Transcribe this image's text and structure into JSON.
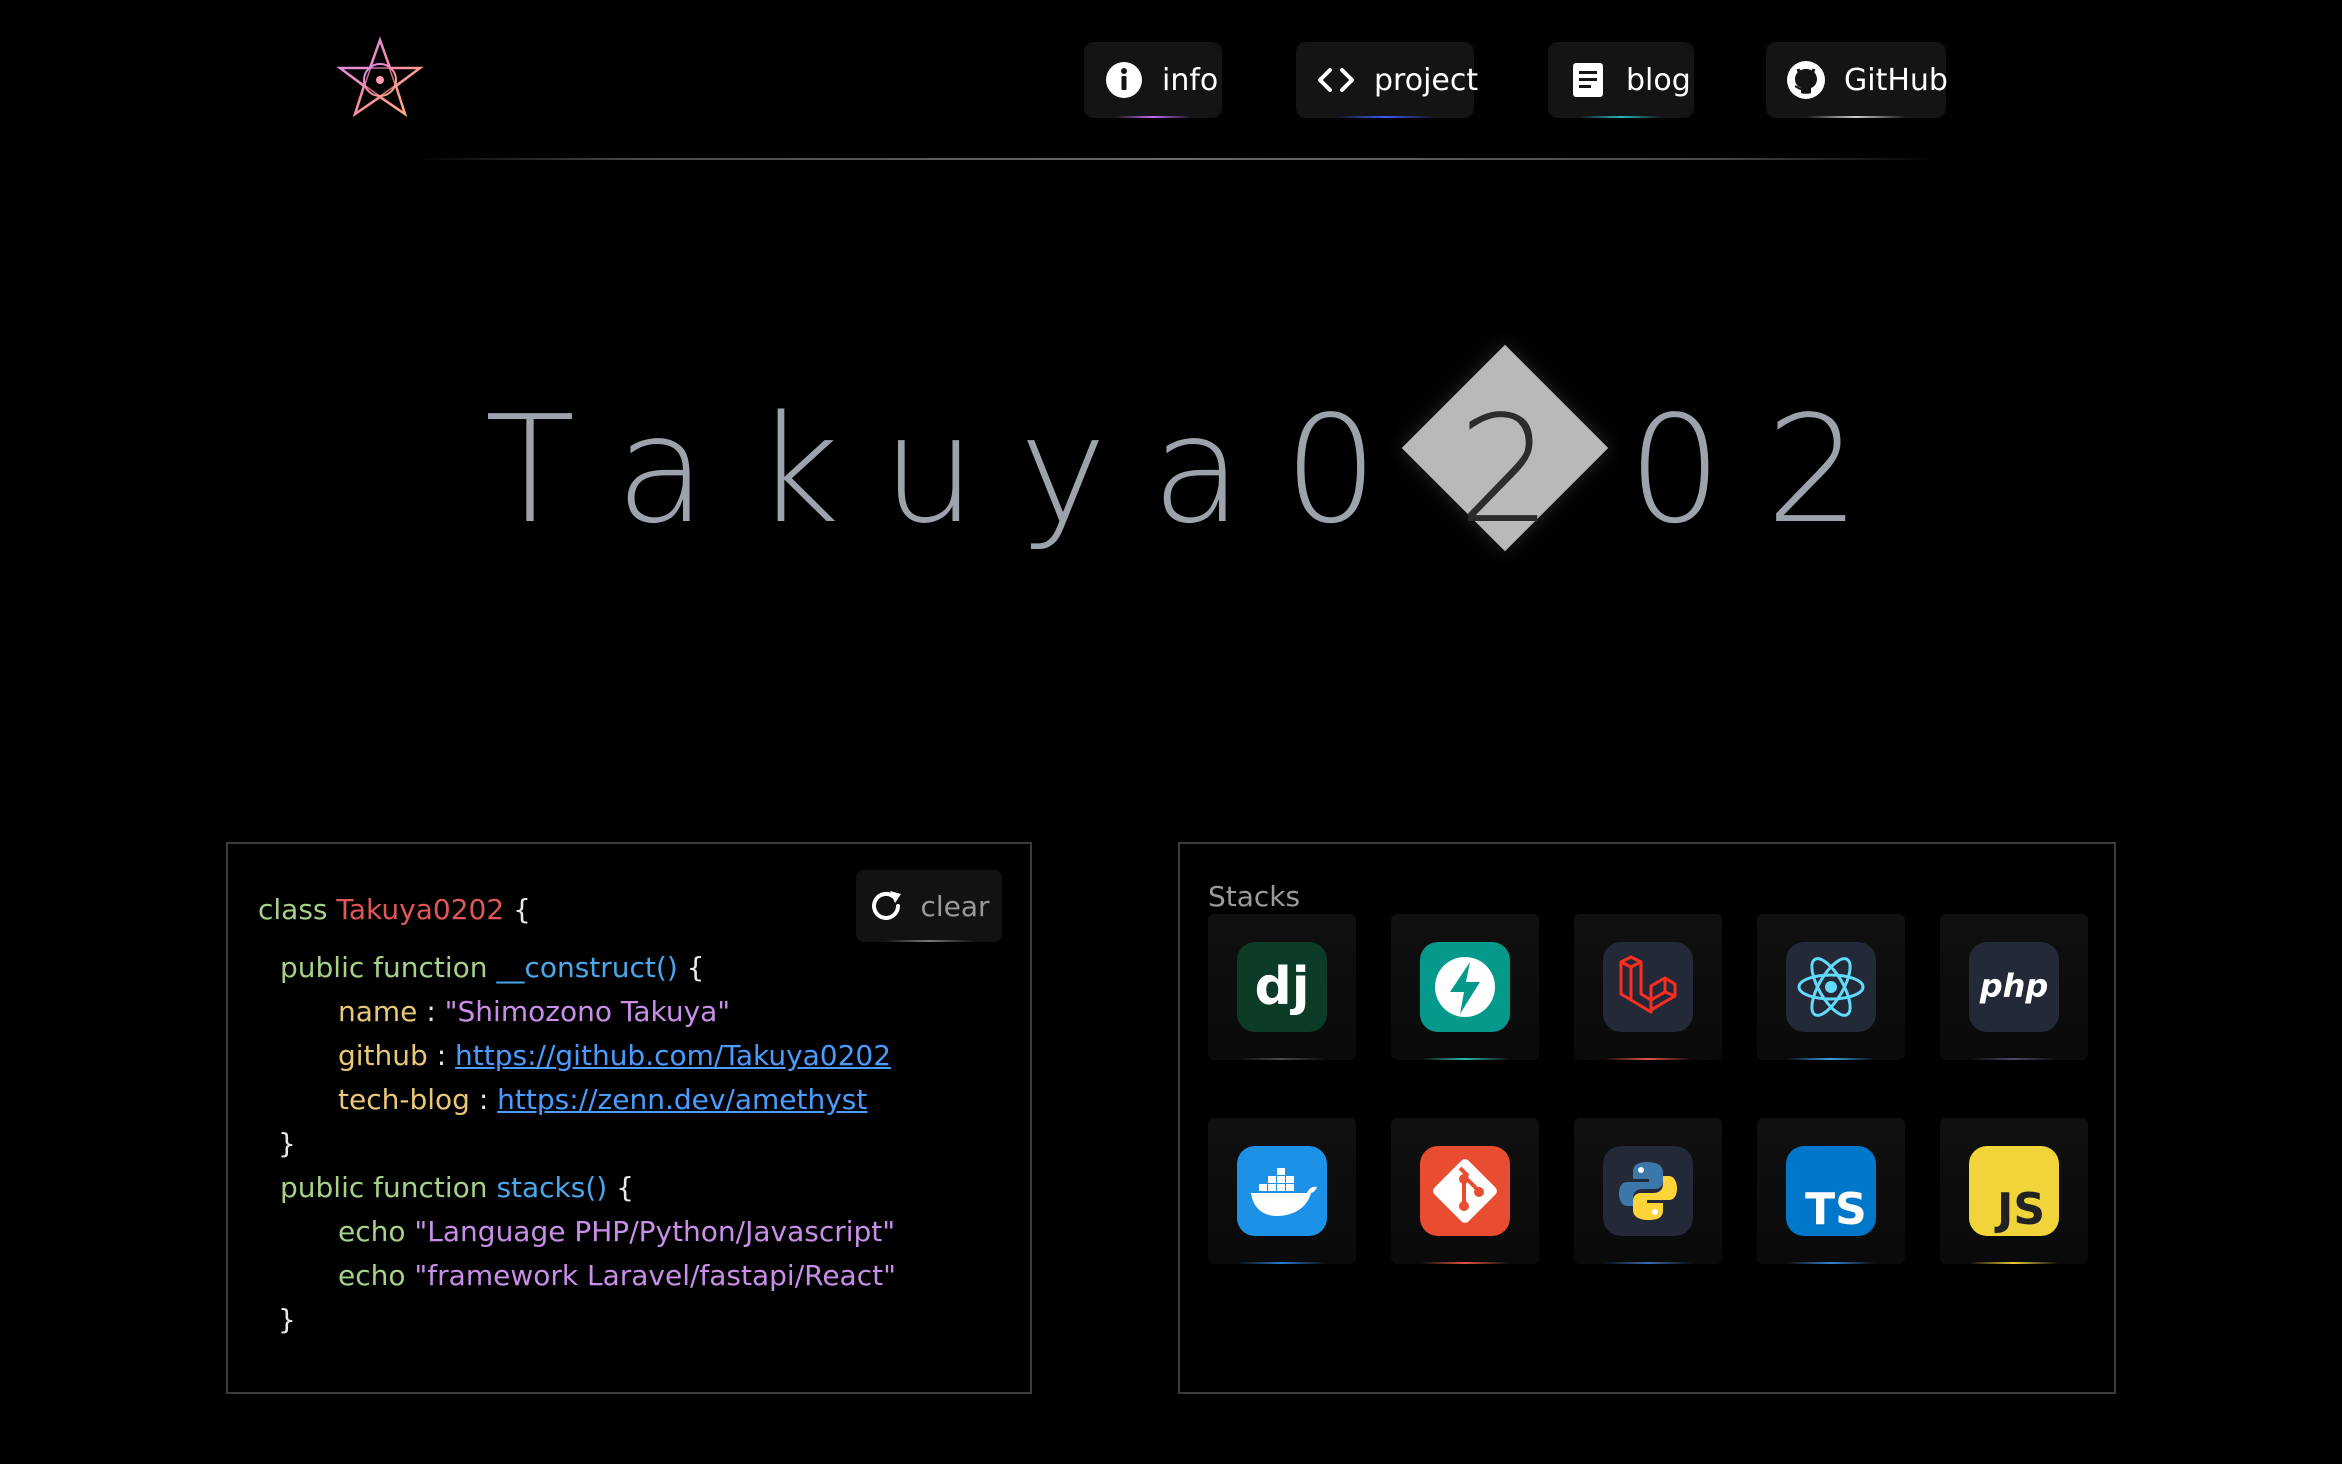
{
  "header": {
    "nav": [
      {
        "label": "info",
        "icon": "info-icon"
      },
      {
        "label": "project",
        "icon": "code-icon"
      },
      {
        "label": "blog",
        "icon": "document-icon"
      },
      {
        "label": "GitHub",
        "icon": "github-icon"
      }
    ]
  },
  "hero": {
    "title": [
      "T",
      "a",
      "k",
      "u",
      "y",
      "a",
      "0",
      "2",
      "0",
      "2"
    ],
    "highlighted_index": 7
  },
  "code": {
    "class_kw": "class",
    "class_name": "Takuya0202",
    "open_brace": "{",
    "construct_kw": "public function",
    "construct_fn": "__construct()",
    "construct_brace": "{",
    "name_key": "name",
    "name_value": "\"Shimozono Takuya\"",
    "github_key": "github",
    "github_value": "https://github.com/Takuya0202",
    "blog_key": "tech-blog",
    "blog_value": "https://zenn.dev/amethyst",
    "colon": ":",
    "close_brace": "}",
    "stacks_kw": "public function",
    "stacks_fn": "stacks()",
    "stacks_brace": "{",
    "echo_kw": "echo",
    "echo_1": "\"Language PHP/Python/Javascript\"",
    "echo_2": "\"framework Laravel/fastapi/React\"",
    "clear_label": "clear"
  },
  "stacks": {
    "title": "Stacks",
    "items": [
      {
        "name": "django",
        "icon": "django-icon",
        "icon_text": "dj",
        "color": "#0c3b28",
        "accent": "#4a4a4a"
      },
      {
        "name": "fastapi",
        "icon": "fastapi-icon",
        "color": "#05998b",
        "accent": "#2ab8a8"
      },
      {
        "name": "laravel",
        "icon": "laravel-icon",
        "color": "#242938",
        "accent": "#e0543c"
      },
      {
        "name": "react",
        "icon": "react-icon",
        "color": "#242938",
        "accent": "#3aa0e0"
      },
      {
        "name": "php",
        "icon": "php-icon",
        "icon_text": "php",
        "color": "#242938",
        "accent": "#4a4a6a"
      },
      {
        "name": "docker",
        "icon": "docker-icon",
        "color": "#1d91e6",
        "accent": "#2a7ad0"
      },
      {
        "name": "git",
        "icon": "git-icon",
        "color": "#e84d31",
        "accent": "#e0543c"
      },
      {
        "name": "python",
        "icon": "python-icon",
        "color": "#242938",
        "accent": "#3a6ab0"
      },
      {
        "name": "typescript",
        "icon": "typescript-icon",
        "icon_text": "TS",
        "color": "#0077c8",
        "accent": "#3a80d0"
      },
      {
        "name": "javascript",
        "icon": "javascript-icon",
        "icon_text": "JS",
        "color": "#f0d43a",
        "accent": "#e8c83a"
      }
    ]
  }
}
